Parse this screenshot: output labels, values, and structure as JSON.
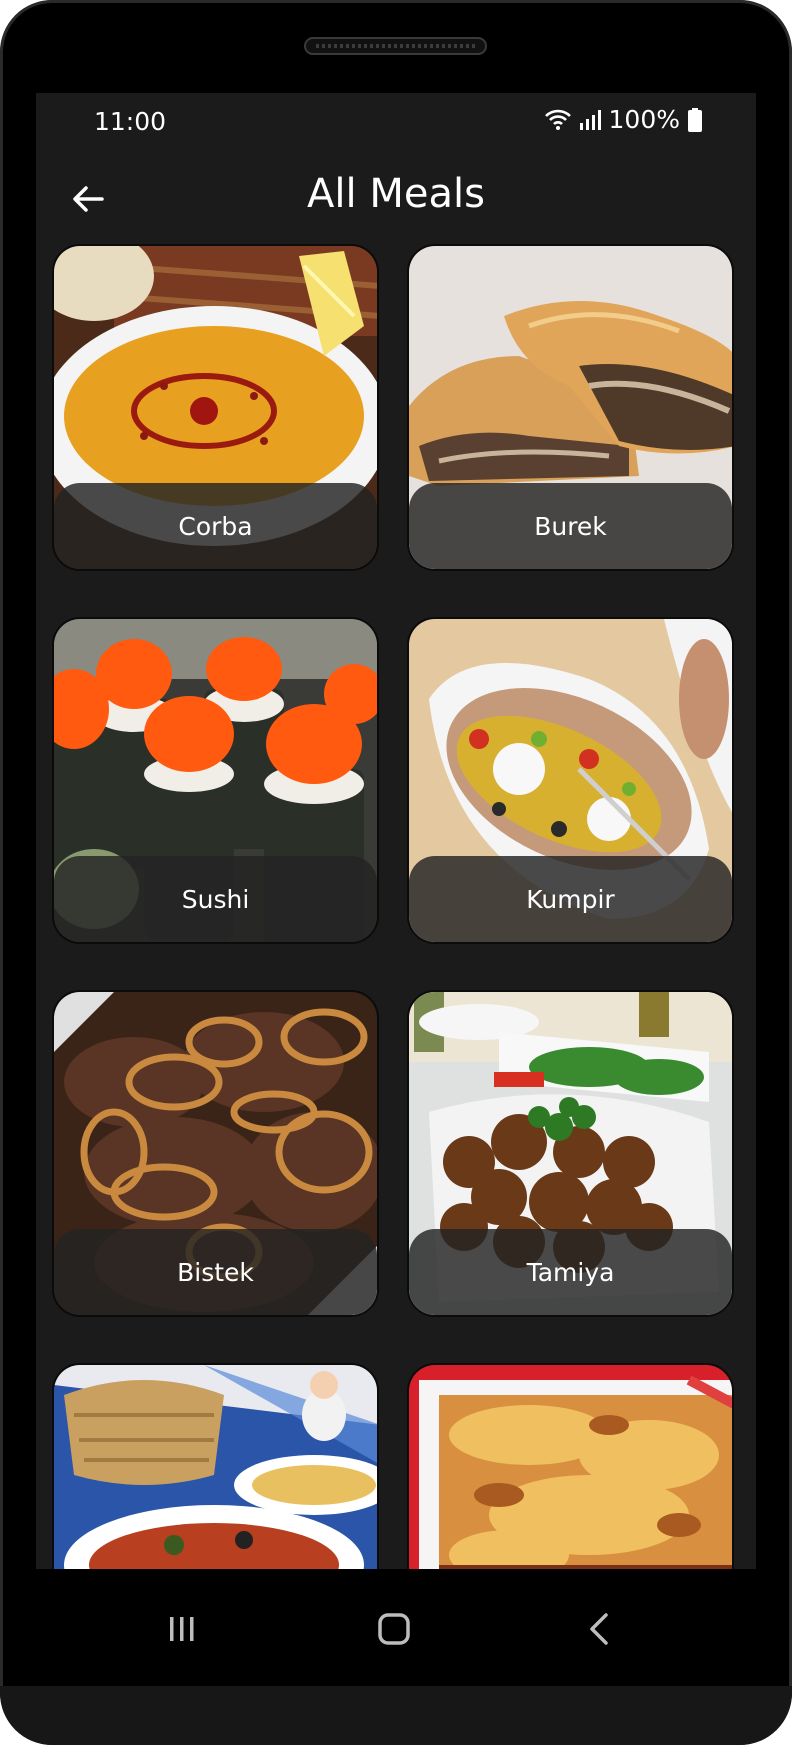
{
  "status_bar": {
    "time": "11:00",
    "battery": "100%",
    "icons": [
      "wifi-icon",
      "signal-icon",
      "battery-icon"
    ]
  },
  "app_bar": {
    "title": "All Meals",
    "back_icon": "arrow-left-icon"
  },
  "meals": [
    {
      "name": "Corba",
      "image": "lentil-soup-photo"
    },
    {
      "name": "Burek",
      "image": "meat-pastry-photo"
    },
    {
      "name": "Sushi",
      "image": "sushi-roe-photo"
    },
    {
      "name": "Kumpir",
      "image": "stuffed-potato-photo"
    },
    {
      "name": "Bistek",
      "image": "steak-onions-photo"
    },
    {
      "name": "Tamiya",
      "image": "falafel-photo"
    },
    {
      "name": "",
      "image": "tunisian-dish-photo"
    },
    {
      "name": "",
      "image": "lasagna-photo"
    }
  ],
  "nav_bar": {
    "icons": [
      "recent-apps-icon",
      "home-icon",
      "back-icon"
    ]
  },
  "colors": {
    "screen_bg": "#1b1b1b",
    "label_bg": "#2a2a2a",
    "text": "#ffffff"
  }
}
